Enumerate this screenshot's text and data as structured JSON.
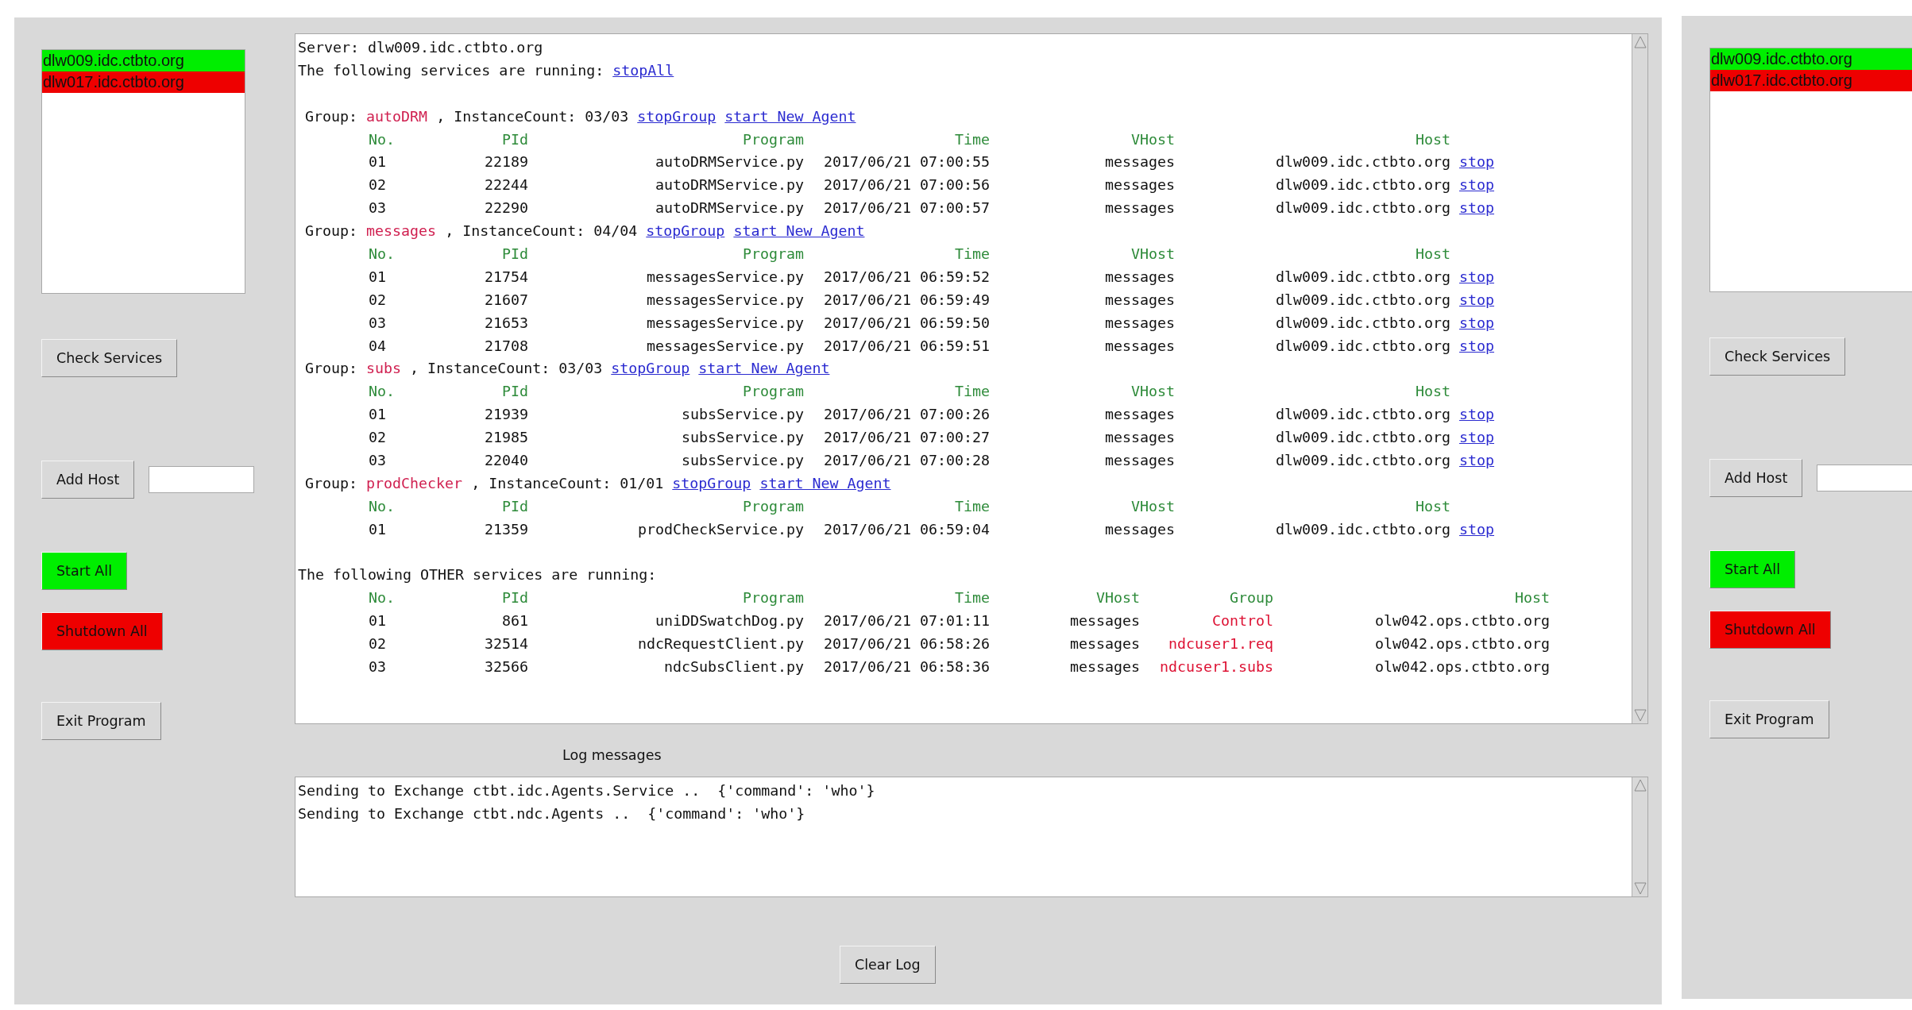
{
  "panels": [
    {
      "hosts": [
        {
          "name": "dlw009.idc.ctbto.org",
          "color": "#00ee00"
        },
        {
          "name": "dlw017.idc.ctbto.org",
          "color": "#ee0000"
        }
      ],
      "buttons": [
        {
          "label": "Check Services",
          "kind": "plain"
        },
        {
          "label": "Add Host",
          "kind": "entry"
        },
        {
          "label": "Start All",
          "kind": "plain",
          "color": "#00ee00"
        },
        {
          "label": "Shutdown All",
          "kind": "plain",
          "color": "#ee0000"
        },
        {
          "label": "Exit Program",
          "kind": "plain"
        }
      ]
    },
    {
      "hosts": [
        {
          "name": "dlw009.idc.ctbto.org",
          "color": "#00ee00"
        },
        {
          "name": "dlw017.idc.ctbto.org",
          "color": "#ee0000"
        }
      ],
      "buttons": [
        {
          "label": "Check Services",
          "kind": "plain"
        },
        {
          "label": "Add Host",
          "kind": "entry"
        },
        {
          "label": "Start All",
          "kind": "plain",
          "color": "#00ee00"
        },
        {
          "label": "Shutdown All",
          "kind": "plain",
          "color": "#ee0000"
        },
        {
          "label": "Exit Program",
          "kind": "plain"
        }
      ]
    }
  ],
  "services": {
    "server": "Server: dlw009.idc.ctbto.org",
    "running": "The following services are running:",
    "stop_all": "stopAll",
    "groups": [
      {
        "label": "Group:",
        "name": "autoDRM",
        "count": ", InstanceCount: 03/03",
        "stop": "stopGroup",
        "start": "start New Agent",
        "columns": [
          "No.",
          "PId",
          "Program",
          "Time",
          "VHost",
          "Host"
        ],
        "rows": [
          {
            "no": "01",
            "pid": "22189",
            "program": "autoDRMService.py",
            "time": "2017/06/21 07:00:55",
            "vhost": "messages",
            "host": "dlw009.idc.ctbto.org",
            "action": "stop"
          },
          {
            "no": "02",
            "pid": "22244",
            "program": "autoDRMService.py",
            "time": "2017/06/21 07:00:56",
            "vhost": "messages",
            "host": "dlw009.idc.ctbto.org",
            "action": "stop"
          },
          {
            "no": "03",
            "pid": "22290",
            "program": "autoDRMService.py",
            "time": "2017/06/21 07:00:57",
            "vhost": "messages",
            "host": "dlw009.idc.ctbto.org",
            "action": "stop"
          }
        ]
      },
      {
        "label": "Group:",
        "name": "messages",
        "count": ", InstanceCount: 04/04",
        "stop": "stopGroup",
        "start": "start New Agent",
        "columns": [
          "No.",
          "PId",
          "Program",
          "Time",
          "VHost",
          "Host"
        ],
        "rows": [
          {
            "no": "01",
            "pid": "21754",
            "program": "messagesService.py",
            "time": "2017/06/21 06:59:52",
            "vhost": "messages",
            "host": "dlw009.idc.ctbto.org",
            "action": "stop"
          },
          {
            "no": "02",
            "pid": "21607",
            "program": "messagesService.py",
            "time": "2017/06/21 06:59:49",
            "vhost": "messages",
            "host": "dlw009.idc.ctbto.org",
            "action": "stop"
          },
          {
            "no": "03",
            "pid": "21653",
            "program": "messagesService.py",
            "time": "2017/06/21 06:59:50",
            "vhost": "messages",
            "host": "dlw009.idc.ctbto.org",
            "action": "stop"
          },
          {
            "no": "04",
            "pid": "21708",
            "program": "messagesService.py",
            "time": "2017/06/21 06:59:51",
            "vhost": "messages",
            "host": "dlw009.idc.ctbto.org",
            "action": "stop"
          }
        ]
      },
      {
        "label": "Group:",
        "name": "subs",
        "count": ", InstanceCount: 03/03",
        "stop": "stopGroup",
        "start": "start New Agent",
        "columns": [
          "No.",
          "PId",
          "Program",
          "Time",
          "VHost",
          "Host"
        ],
        "rows": [
          {
            "no": "01",
            "pid": "21939",
            "program": "subsService.py",
            "time": "2017/06/21 07:00:26",
            "vhost": "messages",
            "host": "dlw009.idc.ctbto.org",
            "action": "stop"
          },
          {
            "no": "02",
            "pid": "21985",
            "program": "subsService.py",
            "time": "2017/06/21 07:00:27",
            "vhost": "messages",
            "host": "dlw009.idc.ctbto.org",
            "action": "stop"
          },
          {
            "no": "03",
            "pid": "22040",
            "program": "subsService.py",
            "time": "2017/06/21 07:00:28",
            "vhost": "messages",
            "host": "dlw009.idc.ctbto.org",
            "action": "stop"
          }
        ]
      },
      {
        "label": "Group:",
        "name": "prodChecker",
        "count": ", InstanceCount: 01/01",
        "stop": "stopGroup",
        "start": "start New Agent",
        "columns": [
          "No.",
          "PId",
          "Program",
          "Time",
          "VHost",
          "Host"
        ],
        "rows": [
          {
            "no": "01",
            "pid": "21359",
            "program": "prodCheckService.py",
            "time": "2017/06/21 06:59:04",
            "vhost": "messages",
            "host": "dlw009.idc.ctbto.org",
            "action": "stop"
          }
        ]
      }
    ],
    "other_heading": "The following OTHER services are running:",
    "other": {
      "columns": [
        "No.",
        "PId",
        "Program",
        "Time",
        "VHost",
        "Group",
        "Host"
      ],
      "rows": [
        {
          "no": "01",
          "pid": "861",
          "program": "uniDDSwatchDog.py",
          "time": "2017/06/21 07:01:11",
          "vhost": "messages",
          "group": "Control",
          "host": "olw042.ops.ctbto.org"
        },
        {
          "no": "02",
          "pid": "32514",
          "program": "ndcRequestClient.py",
          "time": "2017/06/21 06:58:26",
          "vhost": "messages",
          "group": "ndcuser1.req",
          "host": "olw042.ops.ctbto.org"
        },
        {
          "no": "03",
          "pid": "32566",
          "program": "ndcSubsClient.py",
          "time": "2017/06/21 06:58:36",
          "vhost": "messages",
          "group": "ndcuser1.subs",
          "host": "olw042.ops.ctbto.org"
        }
      ]
    }
  },
  "log": {
    "title": "Log messages",
    "lines": [
      "Sending to Exchange ctbt.idc.Agents.Service ..  {'command': 'who'}",
      "Sending to Exchange ctbt.ndc.Agents ..  {'command': 'who'}"
    ]
  },
  "clear_log": "Clear Log"
}
